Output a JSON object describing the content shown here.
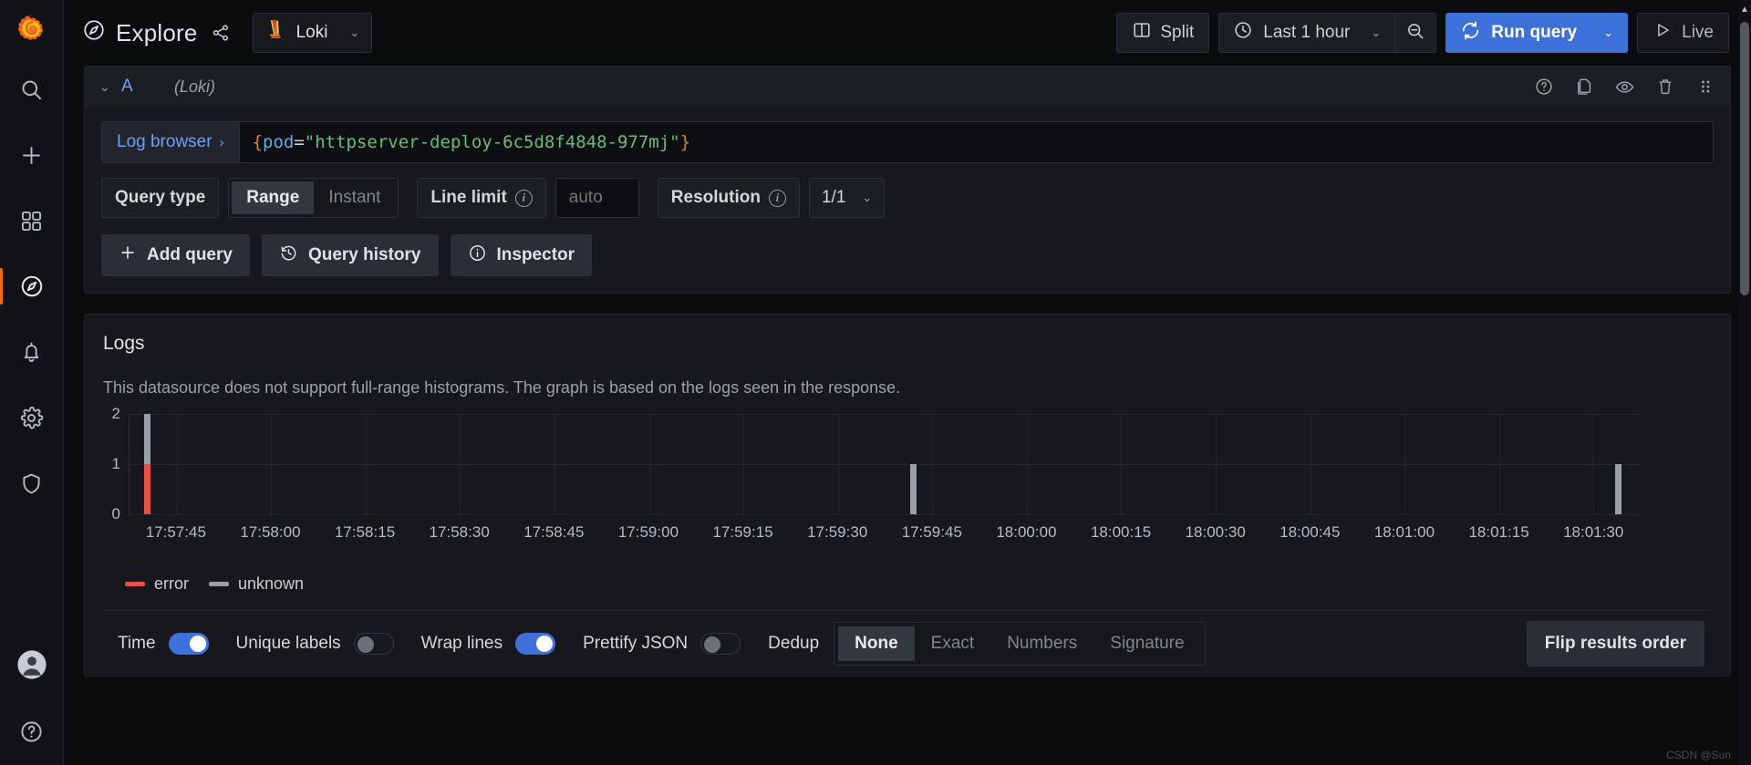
{
  "nav": {
    "logo": "grafana-logo",
    "items": [
      {
        "name": "search",
        "icon": "search-icon"
      },
      {
        "name": "add",
        "icon": "plus-icon"
      },
      {
        "name": "dashboards",
        "icon": "dashboards-icon"
      },
      {
        "name": "explore",
        "icon": "compass-icon",
        "active": true
      },
      {
        "name": "alerting",
        "icon": "bell-icon"
      },
      {
        "name": "configuration",
        "icon": "gear-icon"
      },
      {
        "name": "server-admin",
        "icon": "shield-icon"
      }
    ],
    "bottom": [
      {
        "name": "profile",
        "icon": "user-avatar-icon"
      },
      {
        "name": "help",
        "icon": "question-circle-icon"
      }
    ]
  },
  "topbar": {
    "title": "Explore",
    "compass_icon": "compass-icon",
    "share_icon": "share-nodes-icon",
    "datasource": {
      "label": "Loki",
      "icon": "loki-logo-icon",
      "caret": "⌄"
    },
    "split_label": "Split",
    "split_icon": "split-panes-icon",
    "time_range": "Last 1 hour",
    "clock_icon": "clock-icon",
    "time_caret": "⌄",
    "zoom_out_icon": "zoom-out-icon",
    "run_query_label": "Run query",
    "run_query_icon": "refresh-icon",
    "run_query_caret": "⌄",
    "live_label": "Live",
    "live_icon": "play-icon"
  },
  "query_row": {
    "collapse_caret": "⌄",
    "ref_id": "A",
    "datasource_name": "(Loki)",
    "actions": [
      {
        "name": "query-help",
        "icon": "question-circle-icon"
      },
      {
        "name": "duplicate-query",
        "icon": "copy-icon"
      },
      {
        "name": "toggle-query-visibility",
        "icon": "eye-icon"
      },
      {
        "name": "remove-query",
        "icon": "trash-icon"
      },
      {
        "name": "drag-query",
        "icon": "drag-handle-icon"
      }
    ],
    "log_browser_label": "Log browser",
    "log_browser_chevron": "›",
    "expression": {
      "full": "{pod=\"httpserver-deploy-6c5d8f4848-977mj\"}",
      "open_brace": "{",
      "label_key": "pod",
      "operator": "=",
      "value": "\"httpserver-deploy-6c5d8f4848-977mj\"",
      "close_brace": "}"
    },
    "options": {
      "query_type_label": "Query type",
      "query_type_values": [
        "Range",
        "Instant"
      ],
      "query_type_selected": "Range",
      "line_limit_label": "Line limit",
      "line_limit_info_icon": "info-circle-icon",
      "line_limit_placeholder": "auto",
      "line_limit_value": "",
      "resolution_label": "Resolution",
      "resolution_info_icon": "info-circle-icon",
      "resolution_selected": "1/1",
      "resolution_caret": "⌄"
    },
    "actions_bar": [
      {
        "name": "add-query",
        "label": "Add query",
        "icon": "plus-icon"
      },
      {
        "name": "query-history",
        "label": "Query history",
        "icon": "history-icon"
      },
      {
        "name": "inspector",
        "label": "Inspector",
        "icon": "info-circle-icon"
      }
    ]
  },
  "logs_panel": {
    "title": "Logs",
    "note": "This datasource does not support full-range histograms. The graph is based on the logs seen in the response.",
    "options": {
      "time_label": "Time",
      "time_on": true,
      "unique_labels_label": "Unique labels",
      "unique_labels_on": false,
      "wrap_lines_label": "Wrap lines",
      "wrap_lines_on": true,
      "prettify_json_label": "Prettify JSON",
      "prettify_json_on": false,
      "dedup_label": "Dedup",
      "dedup_options": [
        "None",
        "Exact",
        "Numbers",
        "Signature"
      ],
      "dedup_selected": "None",
      "flip_results_label": "Flip results order"
    }
  },
  "chart_data": {
    "type": "bar",
    "title": "",
    "xlabel": "",
    "ylabel": "",
    "stacked": true,
    "grid": true,
    "legend_position": "bottom-left",
    "ylim": [
      0,
      2
    ],
    "yticks": [
      0,
      1,
      2
    ],
    "ytick_labels": [
      "0",
      "1",
      "2"
    ],
    "xlim": [
      "17:57:41",
      "18:01:36"
    ],
    "xticks": [
      "17:57:45",
      "17:58:00",
      "17:58:15",
      "17:58:30",
      "17:58:45",
      "17:59:00",
      "17:59:15",
      "17:59:30",
      "17:59:45",
      "18:00:00",
      "18:00:15",
      "18:00:30",
      "18:00:45",
      "18:01:00",
      "18:01:15",
      "18:01:30"
    ],
    "series": [
      {
        "name": "error",
        "color": "#e5504a",
        "points": [
          {
            "x": "17:57:44",
            "y": 1
          }
        ]
      },
      {
        "name": "unknown",
        "color": "#9a9ea6",
        "points": [
          {
            "x": "17:57:44",
            "y": 1
          },
          {
            "x": "17:59:44",
            "y": 1
          },
          {
            "x": "18:01:33",
            "y": 1
          }
        ]
      }
    ],
    "bars": [
      {
        "x": "17:57:44",
        "x_frac": 0.012,
        "segments": [
          {
            "series": "error",
            "value": 1
          },
          {
            "series": "unknown",
            "value": 1
          }
        ],
        "total": 2
      },
      {
        "x": "17:59:44",
        "x_frac": 0.519,
        "segments": [
          {
            "series": "unknown",
            "value": 1
          }
        ],
        "total": 1
      },
      {
        "x": "18:01:33",
        "x_frac": 0.9855,
        "segments": [
          {
            "series": "unknown",
            "value": 1
          }
        ],
        "total": 1
      }
    ],
    "legend": [
      {
        "label": "error",
        "color": "#e5504a"
      },
      {
        "label": "unknown",
        "color": "#9a9ea6"
      }
    ]
  },
  "watermark": "CSDN @Sun"
}
